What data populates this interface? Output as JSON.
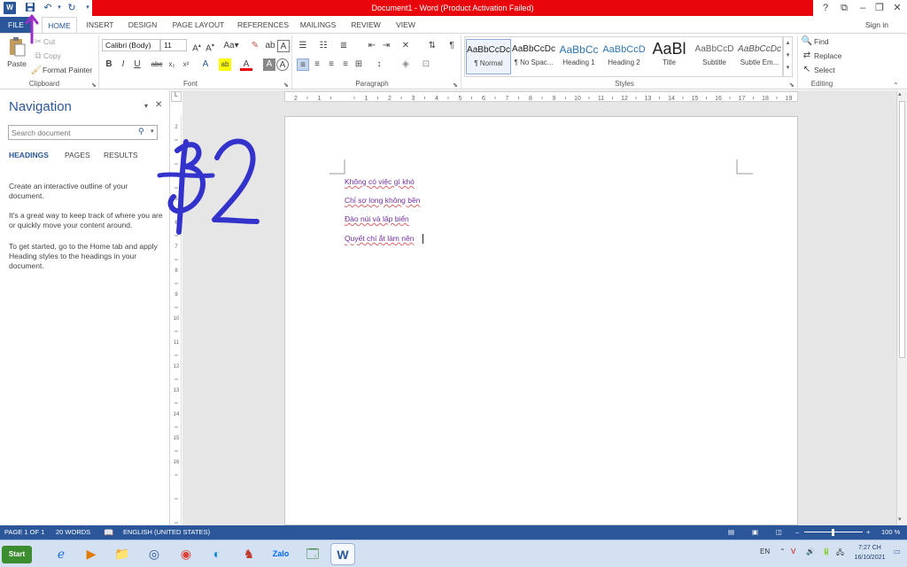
{
  "window": {
    "title": "Document1 - Word (Product Activation Failed)",
    "signin": "Sign in",
    "help": "?"
  },
  "tabs": [
    "FILE",
    "HOME",
    "INSERT",
    "DESIGN",
    "PAGE LAYOUT",
    "REFERENCES",
    "MAILINGS",
    "REVIEW",
    "VIEW"
  ],
  "ribbon": {
    "clipboard": {
      "label": "Clipboard",
      "paste": "Paste",
      "cut": "Cut",
      "copy": "Copy",
      "format_painter": "Format Painter"
    },
    "font": {
      "label": "Font",
      "font_name": "Calibri (Body)",
      "font_size": "11"
    },
    "paragraph": {
      "label": "Paragraph"
    },
    "styles": {
      "label": "Styles",
      "items": [
        {
          "preview": "AaBbCcDc",
          "name": "¶ Normal"
        },
        {
          "preview": "AaBbCcDc",
          "name": "¶ No Spac..."
        },
        {
          "preview": "AaBbCc",
          "name": "Heading 1"
        },
        {
          "preview": "AaBbCcD",
          "name": "Heading 2"
        },
        {
          "preview": "AaBl",
          "name": "Title"
        },
        {
          "preview": "AaBbCcD",
          "name": "Subtitle"
        },
        {
          "preview": "AaBbCcDc",
          "name": "Subtle Em..."
        }
      ]
    },
    "editing": {
      "label": "Editing",
      "find": "Find",
      "replace": "Replace",
      "select": "Select"
    }
  },
  "navigation": {
    "title": "Navigation",
    "search_placeholder": "Search document",
    "tabs": [
      "HEADINGS",
      "PAGES",
      "RESULTS"
    ],
    "paragraphs": [
      "Create an interactive outline of your document.",
      "It's a great way to keep track of where you are or quickly move your content around.",
      "To get started, go to the Home tab and apply Heading styles to the headings in your document."
    ]
  },
  "document": {
    "lines": [
      "Không có việc gì khó",
      "Chỉ sợ long không bền",
      "Đào núi và lấp biển",
      "Quyết chí ắt làm nên"
    ]
  },
  "statusbar": {
    "page": "PAGE 1 OF 1",
    "words": "20 WORDS",
    "language": "ENGLISH (UNITED STATES)",
    "zoom": "100 %"
  },
  "taskbar": {
    "start": "Start",
    "language": "EN",
    "time": "7:27 CH",
    "date": "16/10/2021"
  },
  "annotation": {
    "handwritten": "B2",
    "ink_color": "#3333cc",
    "arrow_color": "#9b30c8"
  },
  "colors": {
    "accent": "#2b579a",
    "title_band": "#e8060c",
    "doc_text": "#7030a0"
  }
}
